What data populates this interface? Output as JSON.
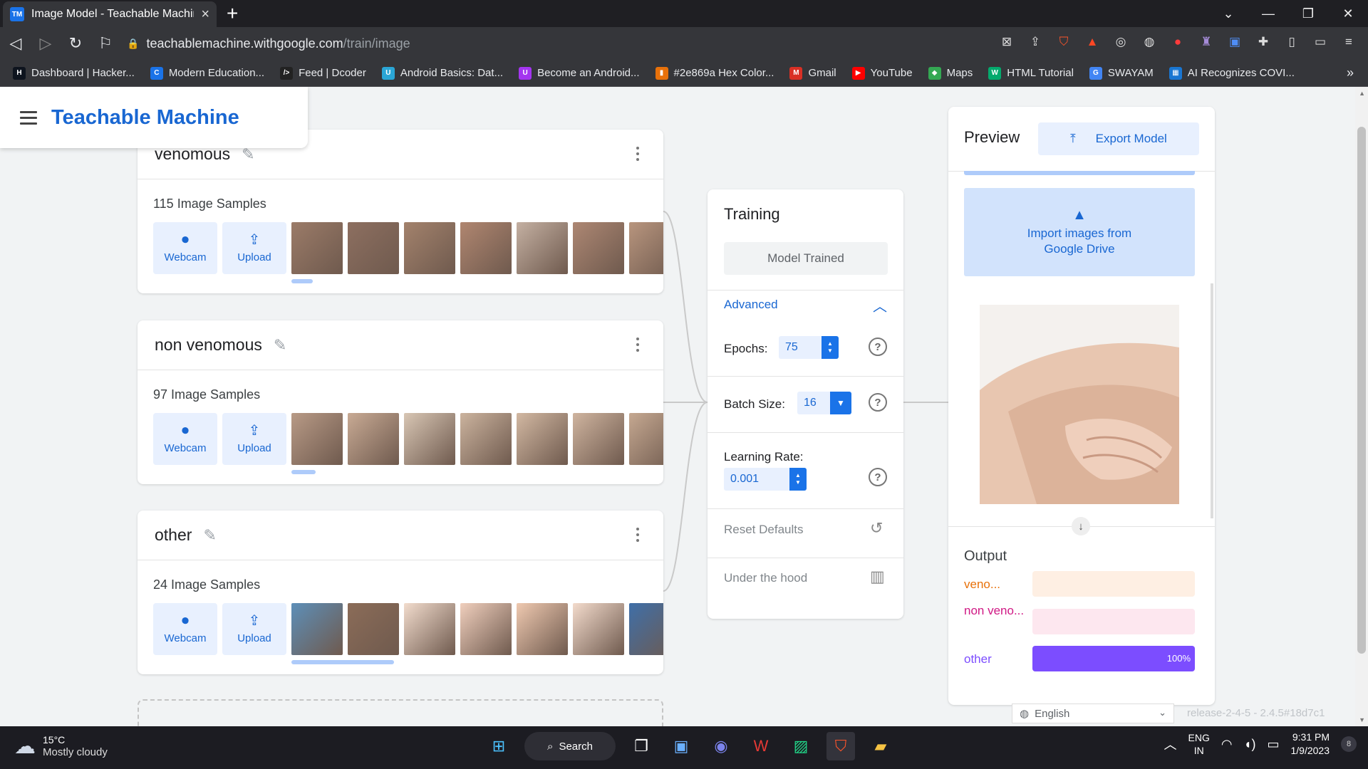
{
  "browser": {
    "tab_title": "Image Model - Teachable Machine",
    "favicon_text": "TM",
    "url_host": "teachablemachine.withgoogle.com",
    "url_path": "/train/image",
    "bookmarks": [
      {
        "label": "Dashboard | Hacker...",
        "icon_text": "H",
        "color": "#0e141e"
      },
      {
        "label": "Modern Education...",
        "icon_text": "C",
        "color": "#1a73e8"
      },
      {
        "label": "Feed | Dcoder",
        "icon_text": "/>",
        "color": "#222222"
      },
      {
        "label": "Android Basics: Dat...",
        "icon_text": "U",
        "color": "#2aa6d6"
      },
      {
        "label": "Become an Android...",
        "icon_text": "U",
        "color": "#a435f0"
      },
      {
        "label": "#2e869a Hex Color...",
        "icon_text": "▮",
        "color": "#e8710a"
      },
      {
        "label": "Gmail",
        "icon_text": "M",
        "color": "#d93025"
      },
      {
        "label": "YouTube",
        "icon_text": "▶",
        "color": "#ff0000"
      },
      {
        "label": "Maps",
        "icon_text": "◆",
        "color": "#34a853"
      },
      {
        "label": "HTML Tutorial",
        "icon_text": "W",
        "color": "#04aa6d"
      },
      {
        "label": "SWAYAM",
        "icon_text": "G",
        "color": "#4285f4"
      },
      {
        "label": "AI Recognizes COVI...",
        "icon_text": "▦",
        "color": "#1976d2"
      }
    ]
  },
  "app": {
    "title": "Teachable Machine"
  },
  "classes": [
    {
      "name": "venomous",
      "samples": "115 Image Samples",
      "webcam_label": "Webcam",
      "upload_label": "Upload",
      "thumbs": [
        "#9b7b68",
        "#8d6f60",
        "#a3826c",
        "#b08670",
        "#c4b0a2",
        "#ad8773",
        "#b8957e"
      ]
    },
    {
      "name": "non venomous",
      "samples": "97 Image Samples",
      "webcam_label": "Webcam",
      "upload_label": "Upload",
      "thumbs": [
        "#b89a86",
        "#c8aa94",
        "#d8c6b4",
        "#cbb39e",
        "#d2b8a2",
        "#cfb49f",
        "#c5a891"
      ]
    },
    {
      "name": "other",
      "samples": "24 Image Samples",
      "webcam_label": "Webcam",
      "upload_label": "Upload",
      "thumbs": [
        "#5d8fb8",
        "#8b6c58",
        "#f2dccd",
        "#f0cfbd",
        "#efc9b0",
        "#f3dbcc",
        "#3f6fa8"
      ]
    }
  ],
  "training": {
    "title": "Training",
    "status_button": "Model Trained",
    "advanced_label": "Advanced",
    "epochs_label": "Epochs:",
    "epochs_value": "75",
    "batch_label": "Batch Size:",
    "batch_value": "16",
    "lr_label": "Learning Rate:",
    "lr_value": "0.001",
    "reset_label": "Reset Defaults",
    "hood_label": "Under the hood"
  },
  "preview": {
    "title": "Preview",
    "export_label": "Export Model",
    "import_line1": "Import images from",
    "import_line2": "Google Drive",
    "output_title": "Output",
    "outputs": [
      {
        "label": "veno...",
        "value": 0,
        "color": "#e8710a",
        "track": "#feefe3",
        "fill": "#e8710a",
        "pct": ""
      },
      {
        "label": "non veno...",
        "value": 0,
        "color": "#d01884",
        "track": "#fde7ef",
        "fill": "#d01884",
        "pct": ""
      },
      {
        "label": "other",
        "value": 1.0,
        "color": "#7c4dff",
        "track": "#ece6ff",
        "fill": "#7c4dff",
        "pct": "100%"
      }
    ]
  },
  "footer": {
    "language": "English",
    "release": "release-2-4-5 - 2.4.5#18d7c1"
  },
  "taskbar": {
    "temperature": "15°C",
    "weather": "Mostly cloudy",
    "search_label": "Search",
    "lang_line1": "ENG",
    "lang_line2": "IN",
    "time": "9:31 PM",
    "date": "1/9/2023",
    "notifications": "8"
  }
}
